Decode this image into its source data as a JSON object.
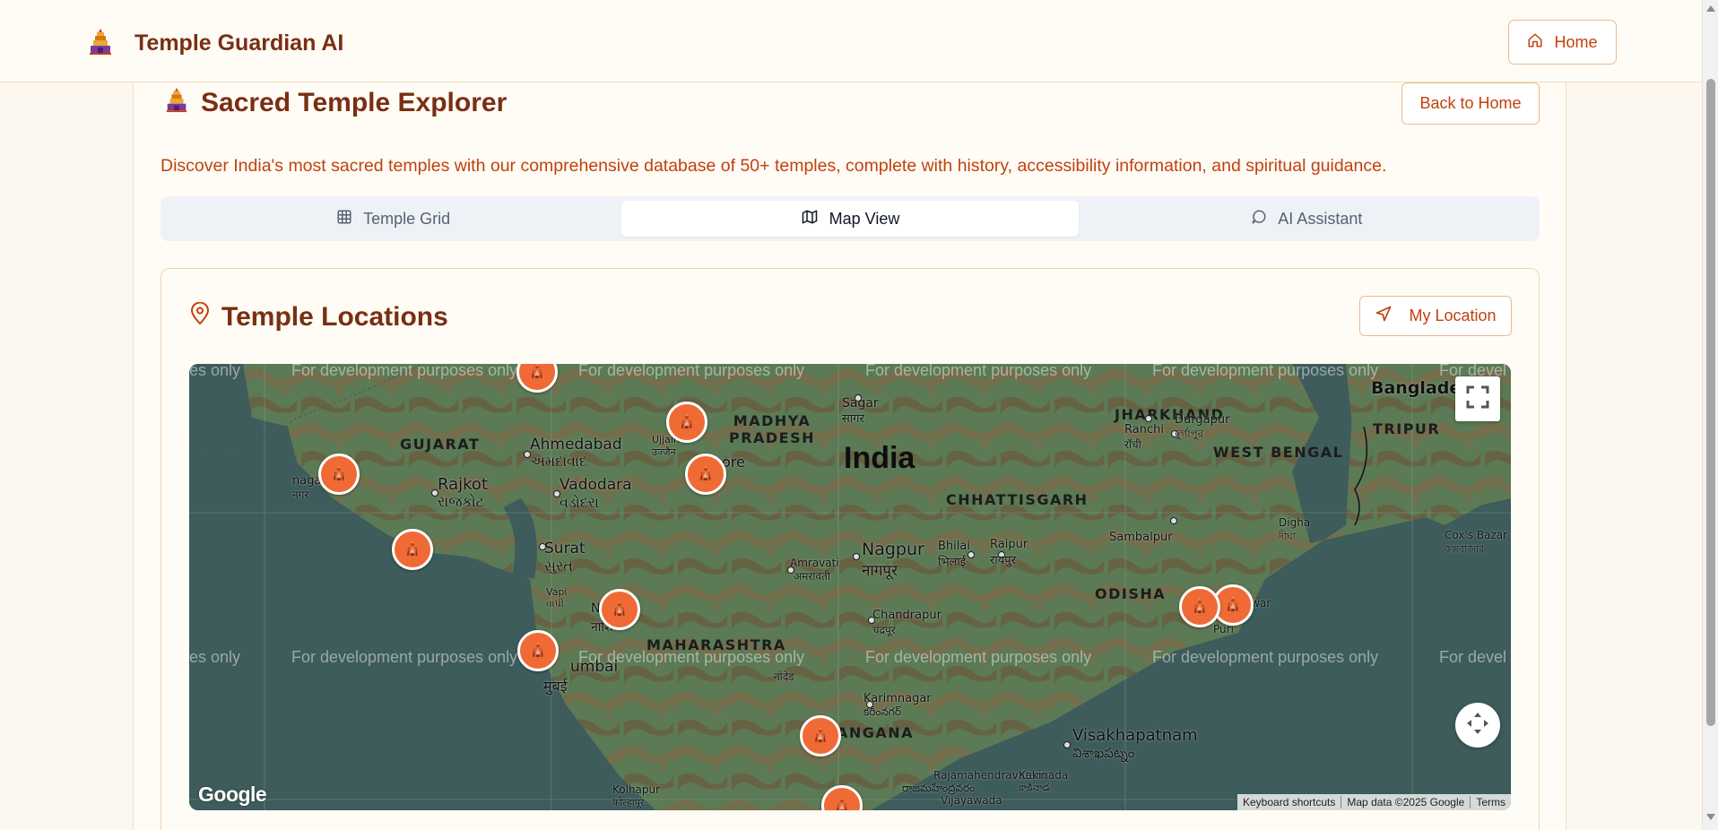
{
  "header": {
    "brand": "Temple Guardian AI",
    "home_label": "Home"
  },
  "explorer": {
    "title": "Sacred Temple Explorer",
    "back_label": "Back to Home",
    "subtitle": "Discover India's most sacred temples with our comprehensive database of 50+ temples, complete with history, accessibility information, and spiritual guidance."
  },
  "tabs": [
    {
      "label": "Temple Grid",
      "icon": "grid-icon",
      "active": false
    },
    {
      "label": "Map View",
      "icon": "map-icon",
      "active": true
    },
    {
      "label": "AI Assistant",
      "icon": "chat-icon",
      "active": false
    }
  ],
  "locations": {
    "title": "Temple Locations",
    "my_location_label": "My Location"
  },
  "map": {
    "watermark": "For development purposes only",
    "watermark_partial_left": "es only",
    "watermark_partial_right": "For devel",
    "country": "India",
    "states": [
      "GUJARAT",
      "MADHYA PRADESH",
      "JHARKHAND",
      "WEST BENGAL",
      "CHHATTISGARH",
      "ODISHA",
      "MAHARASHTRA",
      "ANGANA"
    ],
    "cities": {
      "ahmedabad": "Ahmedabad",
      "ahmedabad_local": "અમદાવાદ",
      "rajkot": "Rajkot",
      "rajkot_local": "રાજકોટ",
      "vadodara": "Vadodara",
      "vadodara_local": "વડોદરા",
      "surat": "Surat",
      "surat_local": "સુરત",
      "nagpur": "Nagpur",
      "nagpur_local": "नागपूर",
      "sagar": "Sagar",
      "sagar_local": "सागर",
      "ranchi": "Ranchi",
      "ranchi_local": "राँची",
      "durgapur": "Durgapur",
      "durgapur_local": "দুর্গাপুর",
      "bhilai": "Bhilai",
      "bhilai_local": "भिलाई",
      "raipur": "Raipur",
      "raipur_local": "रायपुर",
      "sambalpur": "Sambalpur",
      "amravati": "Amravati",
      "amravati_local": "अमरावती",
      "chandrapur": "Chandrapur",
      "chandrapur_local": "चंद्रपूर",
      "karimnagar": "Karimnagar",
      "karimnagar_local": "కరీంనగర్",
      "visakhapatnam": "Visakhapatnam",
      "visakhapatnam_local": "విశాఖపట్నం",
      "rajahmundry": "Rajamahendravaram",
      "rajahmundry_local": "రాజమహేంద్రవరం",
      "kakinada": "Kakinada",
      "kakinada_local": "కాకినాడ",
      "vijayawada": "Vijayawada",
      "kolhapur": "Kolhapur",
      "kolhapur_local": "कोल्हापूर",
      "mumbai": "umbai",
      "mumbai_local": "मुंबई",
      "vapi": "Vapi",
      "vapi_local": "વાપી",
      "digha": "Digha",
      "digha_local": "দীঘা",
      "coxs": "Cox's Bazar",
      "coxs_local": "কক্সবাজার",
      "bangladesh": "Banglade",
      "tripura": "TRIPUR",
      "puri": "Puri",
      "bhubaneswar": "neswar",
      "nashik": "N",
      "nashik_local": "नाशि",
      "jamnagar": "nagar",
      "jamnagar_local": "नगर",
      "ujjain": "Ujjain",
      "ujjain_local": "उज्जैन",
      "indore": "ore",
      "nanded": "नांदेड"
    },
    "temples": [
      {
        "name": "temple-marker-north-rajasthan"
      },
      {
        "name": "temple-marker-ujjain"
      },
      {
        "name": "temple-marker-omkareshwar"
      },
      {
        "name": "temple-marker-dwarka"
      },
      {
        "name": "temple-marker-somnath"
      },
      {
        "name": "temple-marker-trimbakeshwar"
      },
      {
        "name": "temple-marker-bhimashankar"
      },
      {
        "name": "temple-marker-puri"
      },
      {
        "name": "temple-marker-srisailam"
      },
      {
        "name": "temple-marker-south"
      }
    ],
    "google_logo": "Google",
    "attribution": [
      "Keyboard shortcuts",
      "Map data ©2025 Google",
      "Terms"
    ]
  }
}
